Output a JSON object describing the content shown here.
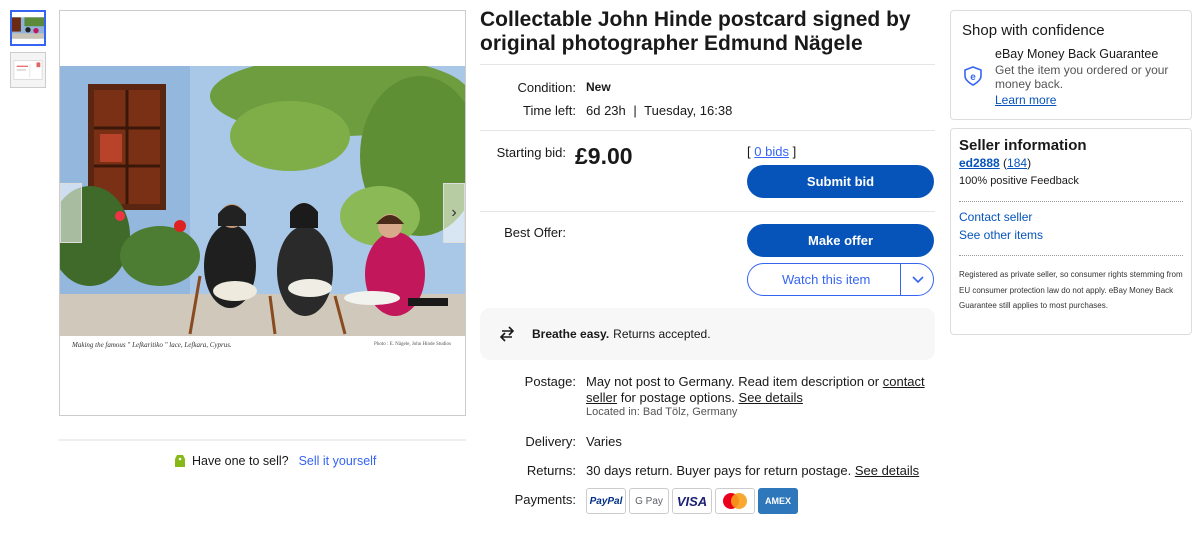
{
  "listing": {
    "title": "Collectable John Hinde postcard signed by original photographer Edmund Nägele"
  },
  "gallery": {
    "caption": "Making the famous \" Lefkaritiko \" lace, Lefkara, Cyprus.",
    "credit": "Photo : E. Nägele, John Hinde Studios",
    "prev_icon": "chevron-left-icon",
    "next_icon": "chevron-right-icon",
    "next_glyph": "›"
  },
  "sell": {
    "question": "Have one to sell?",
    "link": "Sell it yourself"
  },
  "details": {
    "condition_label": "Condition:",
    "condition_value": "New",
    "time_label": "Time left:",
    "time_value": "6d 23h",
    "time_sep": "|",
    "time_end": "Tuesday, 16:38",
    "starting_bid_label": "Starting bid:",
    "price": "£9.00",
    "bids_open": "[",
    "bids_link": "0 bids",
    "bids_close": "]",
    "submit_bid": "Submit bid",
    "best_offer_label": "Best Offer:",
    "make_offer": "Make offer",
    "watch": "Watch this item",
    "watch_chevron": "⌵"
  },
  "breathe": {
    "bold": "Breathe easy.",
    "text": "Returns accepted."
  },
  "postage": {
    "label": "Postage:",
    "text_a": "May not post to Germany. Read item description or",
    "contact_link": "contact seller",
    "text_b": "for postage options.",
    "details_link": "See details",
    "located": "Located in: Bad Tölz, Germany"
  },
  "delivery": {
    "label": "Delivery:",
    "value": "Varies"
  },
  "returns": {
    "label": "Returns:",
    "value": "30 days return. Buyer pays for return postage.",
    "details_link": "See details"
  },
  "payments": {
    "label": "Payments:",
    "methods": [
      "PayPal",
      "G Pay",
      "VISA",
      "Mastercard",
      "AMEX"
    ]
  },
  "confidence": {
    "heading": "Shop with confidence",
    "mbg_title": "eBay Money Back Guarantee",
    "mbg_desc": "Get the item you ordered or your money back.",
    "learn_more": "Learn more"
  },
  "seller": {
    "heading": "Seller information",
    "name": "ed2888",
    "count_open": "(",
    "count": "184",
    "count_close": ")",
    "feedback": "100% positive Feedback",
    "contact": "Contact seller",
    "other_items": "See other items",
    "note": "Registered as private seller, so consumer rights stemming from EU consumer protection law do not apply. eBay Money Back Guarantee still applies to most purchases."
  },
  "colors": {
    "accent": "#3665f3",
    "link": "#0654ba"
  }
}
